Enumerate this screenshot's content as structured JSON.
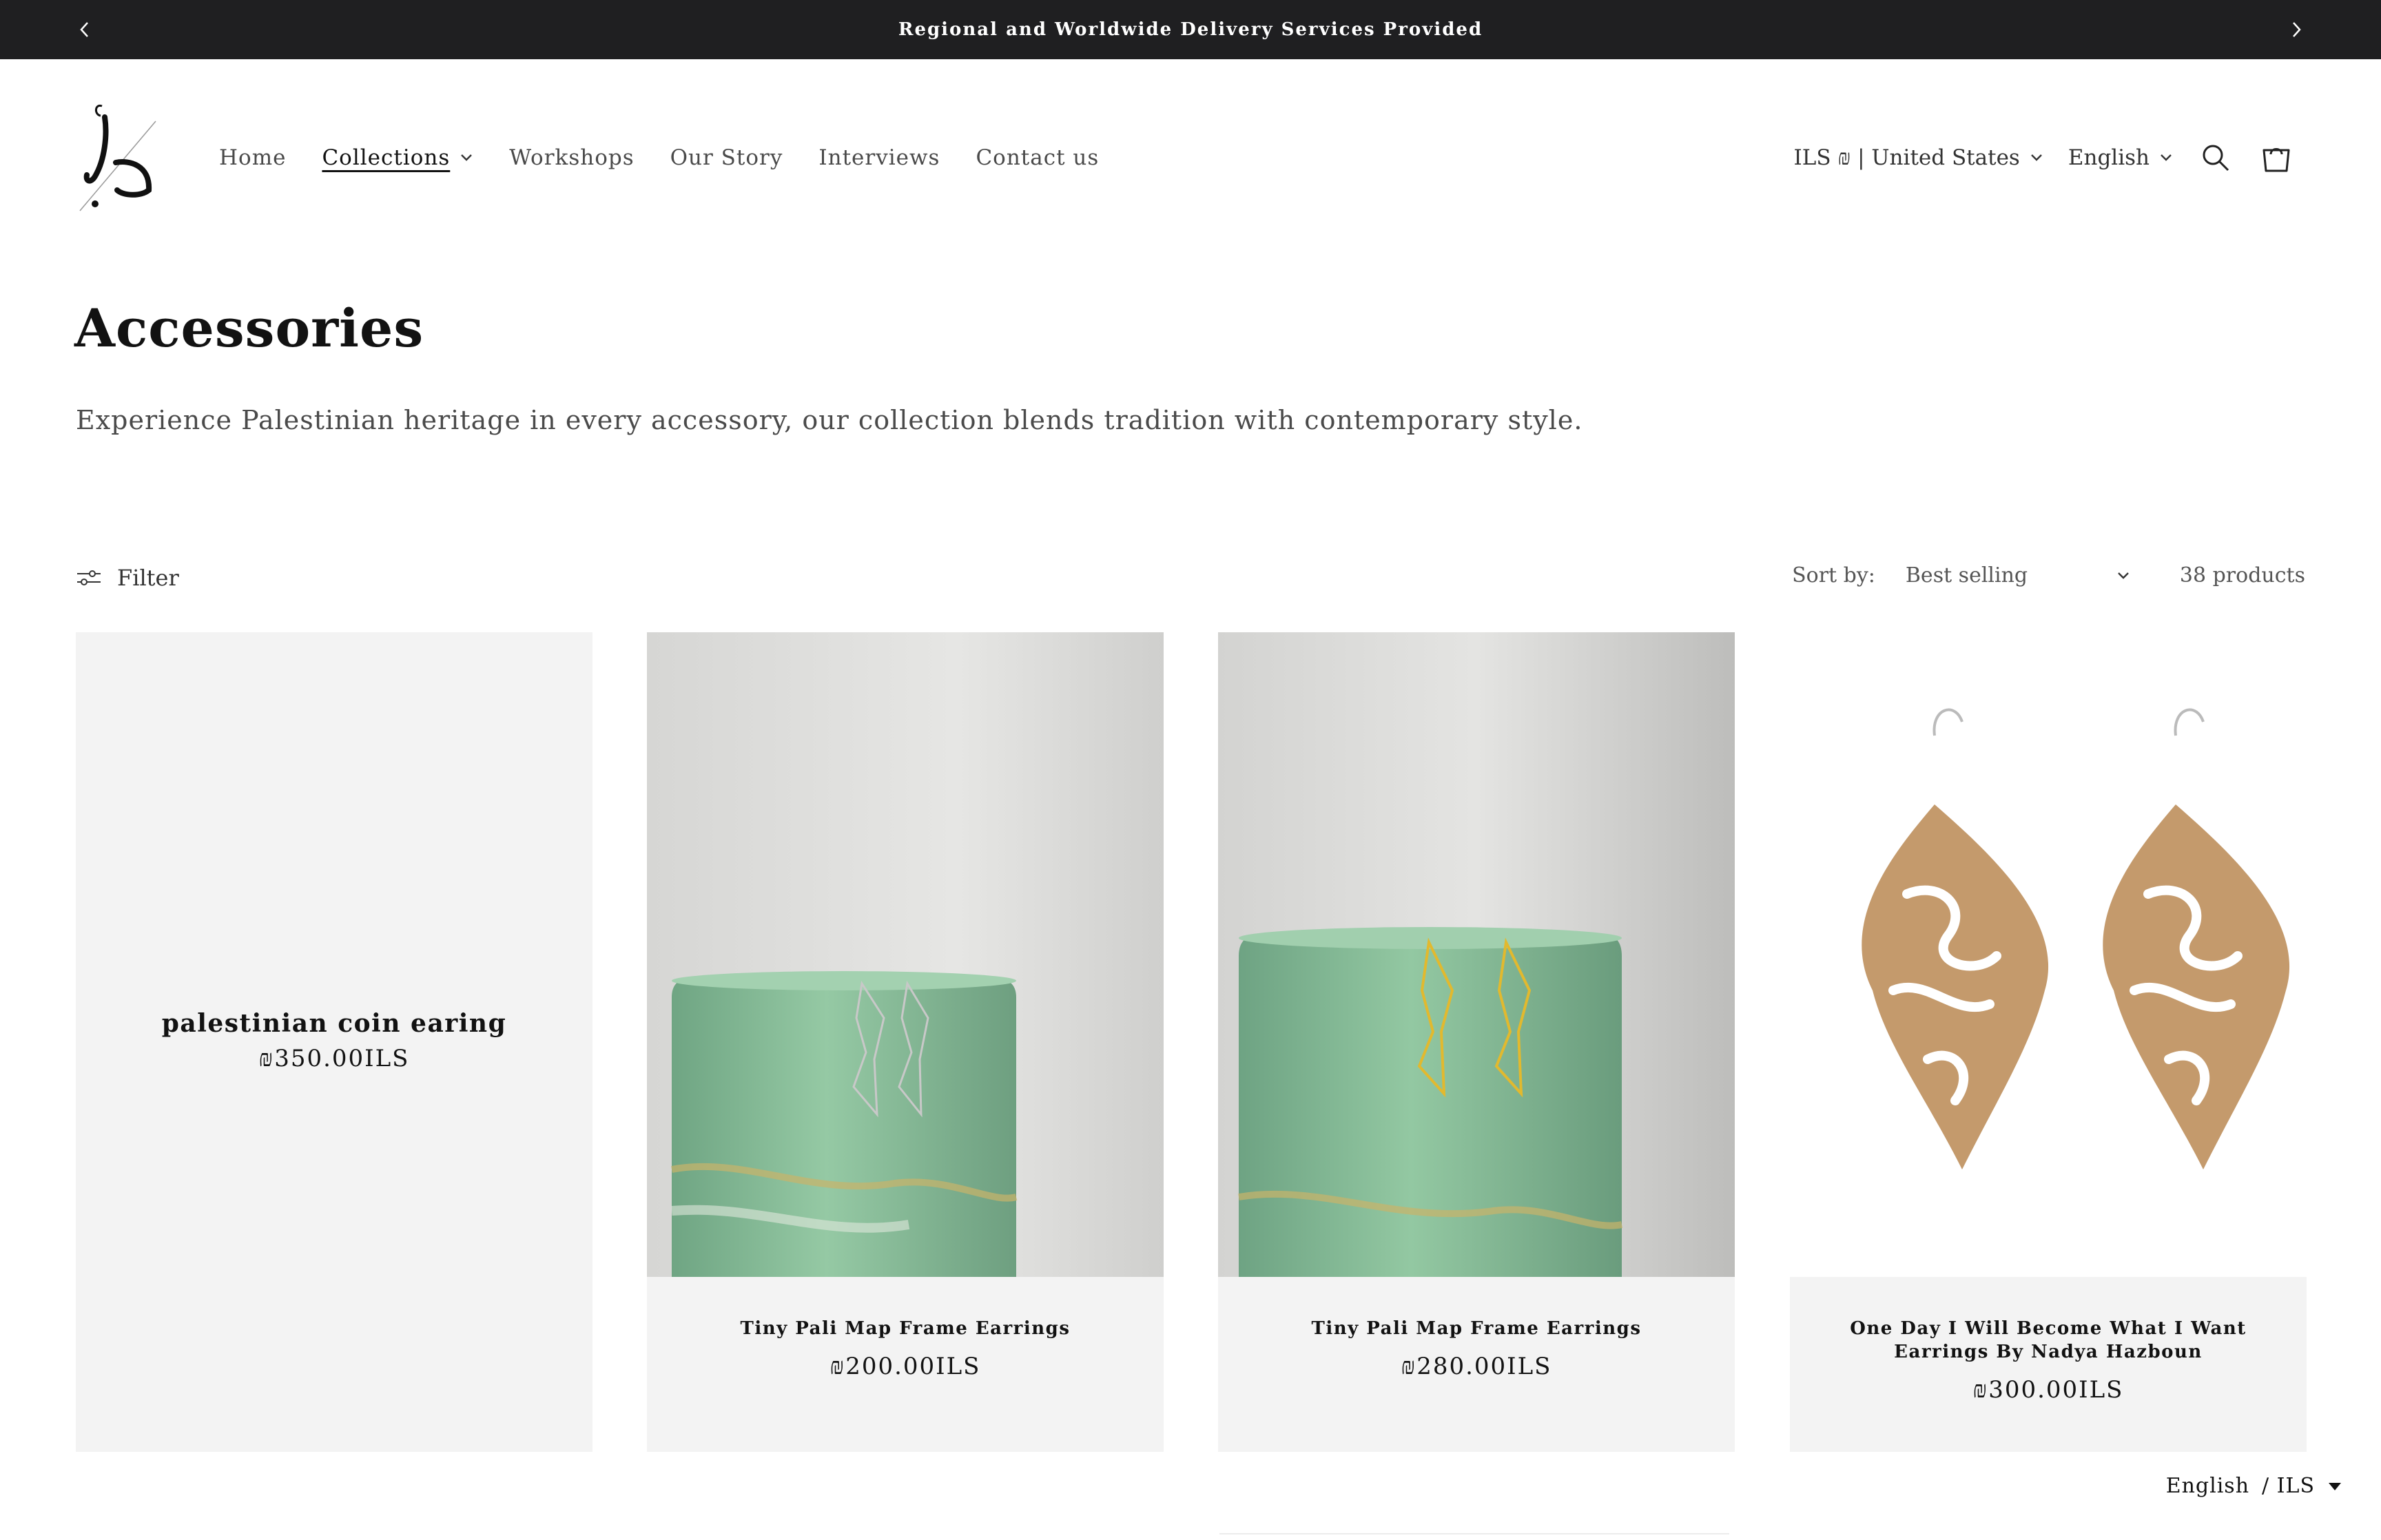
{
  "announcement": {
    "text": "Regional and Worldwide Delivery Services Provided"
  },
  "nav": {
    "items": [
      {
        "label": "Home",
        "has_dropdown": false,
        "active": false
      },
      {
        "label": "Collections",
        "has_dropdown": true,
        "active": true
      },
      {
        "label": "Workshops",
        "has_dropdown": false,
        "active": false
      },
      {
        "label": "Our Story",
        "has_dropdown": false,
        "active": false
      },
      {
        "label": "Interviews",
        "has_dropdown": false,
        "active": false
      },
      {
        "label": "Contact us",
        "has_dropdown": false,
        "active": false
      }
    ]
  },
  "header": {
    "currency_selector": "ILS ₪ | United States",
    "language_selector": "English",
    "icons": [
      "search-icon",
      "cart-icon"
    ]
  },
  "collection": {
    "title": "Accessories",
    "description": "Experience Palestinian heritage in every accessory, our collection blends tradition with contemporary style."
  },
  "toolbar": {
    "filter_label": "Filter",
    "sort_label": "Sort by:",
    "sort_value": "Best selling",
    "product_count": "38 products"
  },
  "products": [
    {
      "name": "palestinian coin earing",
      "price": "₪350.00ILS",
      "has_image": false
    },
    {
      "name": "Tiny Pali Map Frame Earrings",
      "price": "₪200.00ILS",
      "has_image": true,
      "metal": "silver"
    },
    {
      "name": "Tiny Pali Map Frame Earrings",
      "price": "₪280.00ILS",
      "has_image": true,
      "metal": "gold"
    },
    {
      "name": "One Day I Will Become What I Want Earrings By Nadya Hazboun",
      "price": "₪300.00ILS",
      "has_image": true,
      "metal": "wood"
    }
  ],
  "locale_float": {
    "language": "English",
    "currency": "/ ILS"
  },
  "colors": {
    "announcement_bg": "#1f1f21",
    "card_bg": "#f3f3f3",
    "text": "#121212",
    "vase_green": "#8fc29d"
  }
}
